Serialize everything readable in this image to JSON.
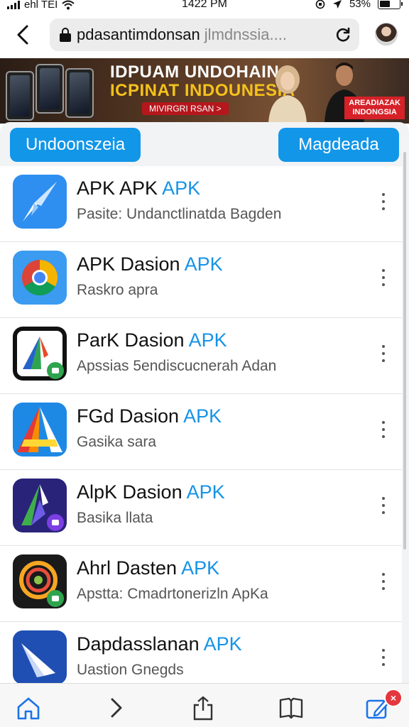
{
  "status_bar": {
    "carrier": "ehl TEI",
    "time": "1422 PM",
    "battery": "53%"
  },
  "address_bar": {
    "url_main": "pdasantimdonsan ",
    "url_dim": "jlmdnssia...."
  },
  "banner": {
    "title_line1": "IDPUAM UNDOHAIN",
    "title_line2": "ICPINAT INDOUNESIA",
    "cta": "MIVIRGRI RSAN >",
    "badge_line1": "AREADIAZAK",
    "badge_line2": "INDONGSIA"
  },
  "actions": {
    "left_button": "Undoonszeia",
    "right_button": "Magdeada"
  },
  "apps": [
    {
      "name": "APK APK ",
      "suffix": "APK",
      "subtitle": "Pasite: Undanctlinatda Bagden",
      "icon": "paper-plane-icon"
    },
    {
      "name": "APK Dasion ",
      "suffix": "APK",
      "subtitle": "Raskro apra",
      "icon": "chrome-icon"
    },
    {
      "name": "ParK Dasion ",
      "suffix": "APK",
      "subtitle": "Apssias 5endiscucnerah Adan",
      "icon": "triangle-android-icon"
    },
    {
      "name": "FGd Dasion ",
      "suffix": "APK",
      "subtitle": "Gasika sara",
      "icon": "colorful-a-icon"
    },
    {
      "name": "AlpK Dasion ",
      "suffix": "APK",
      "subtitle": "Basika llata",
      "icon": "purple-a-icon"
    },
    {
      "name": "Ahrl Dasten ",
      "suffix": "APK",
      "subtitle": "Apstta: Cmadrtonerizln ApKa",
      "icon": "orbit-icon"
    },
    {
      "name": "Dapdasslanan ",
      "suffix": "APK",
      "subtitle": "Uastion Gnegds",
      "icon": "blue-pen-icon"
    }
  ],
  "toolbar": {
    "tab_count_badge": "×"
  },
  "colors": {
    "accent_blue": "#1296e8",
    "apk_blue": "#1693e6",
    "badge_red": "#e3383e"
  }
}
